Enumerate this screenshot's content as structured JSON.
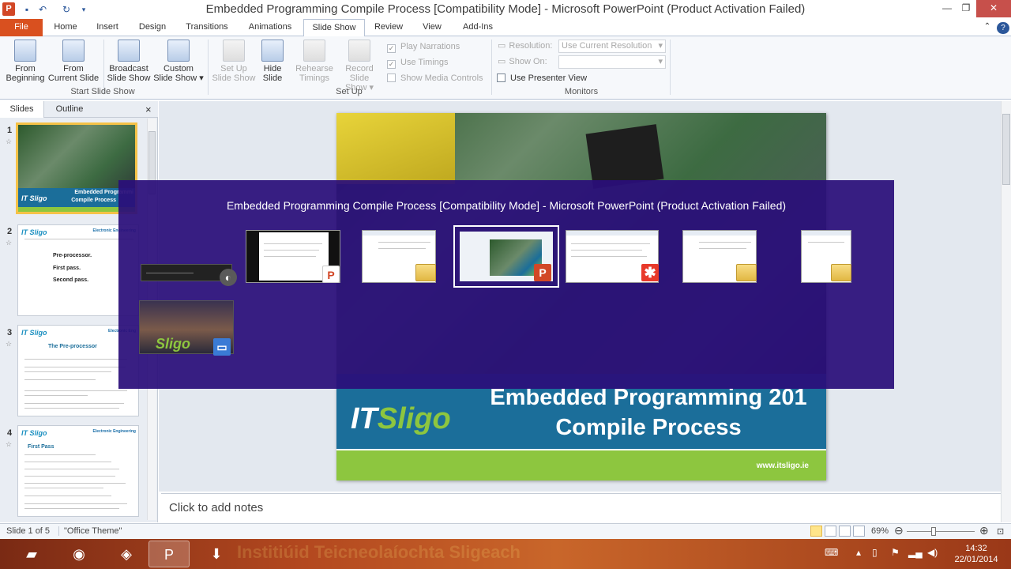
{
  "window": {
    "title": "Embedded Programming Compile Process [Compatibility Mode]  -  Microsoft PowerPoint (Product Activation Failed)",
    "app_icon": "P"
  },
  "ribbon_tabs": [
    "File",
    "Home",
    "Insert",
    "Design",
    "Transitions",
    "Animations",
    "Slide Show",
    "Review",
    "View",
    "Add-Ins"
  ],
  "ribbon": {
    "from_beginning": [
      "From",
      "Beginning"
    ],
    "from_current": [
      "From",
      "Current Slide"
    ],
    "broadcast": [
      "Broadcast",
      "Slide Show"
    ],
    "custom": [
      "Custom",
      "Slide Show"
    ],
    "group_start": "Start Slide Show",
    "setup": [
      "Set Up",
      "Slide Show"
    ],
    "hide": [
      "Hide",
      "Slide"
    ],
    "rehearse": [
      "Rehearse",
      "Timings"
    ],
    "record": [
      "Record Slide",
      "Show"
    ],
    "play_narrations": "Play Narrations",
    "use_timings": "Use Timings",
    "show_media_controls": "Show Media Controls",
    "group_setup": "Set Up",
    "resolution_label": "Resolution:",
    "resolution_value": "Use Current Resolution",
    "show_on_label": "Show On:",
    "show_on_value": "",
    "use_presenter_view": "Use Presenter View",
    "group_monitors": "Monitors"
  },
  "panel": {
    "tab_slides": "Slides",
    "tab_outline": "Outline",
    "close": "×"
  },
  "slides": [
    {
      "num": "1",
      "logo": "IT Sligo",
      "title_a": "Embedded Programmi",
      "title_b": "Compile Process"
    },
    {
      "num": "2",
      "logo": "IT Sligo",
      "header": "Electronic Engineering",
      "lines": [
        "Pre-processor.",
        "First pass.",
        "Second pass."
      ]
    },
    {
      "num": "3",
      "logo": "IT Sligo",
      "header": "Electronic Eng",
      "title": "The Pre-processor"
    },
    {
      "num": "4",
      "logo": "IT Sligo",
      "header": "Electronic Engineering",
      "title": "First Pass"
    }
  ],
  "main_slide": {
    "logo_it": "IT",
    "logo_sligo": "Sligo",
    "title_line1": "Embedded Programming 201",
    "title_line2": "Compile Process",
    "url": "www.itsligo.ie"
  },
  "notes_placeholder": "Click to add notes",
  "status": {
    "slide": "Slide 1 of 5",
    "theme": "\"Office Theme\"",
    "zoom": "69%",
    "zoom_level": 0.69
  },
  "switcher": {
    "title": "Embedded Programming Compile Process [Compatibility Mode] - Microsoft PowerPoint (Product Activation Failed)"
  },
  "taskbar": {
    "watermark": "Institiúid Teicneolaíochta Sligeach",
    "time": "14:32",
    "date": "22/01/2014"
  },
  "colors": {
    "accent_file": "#d9501f",
    "switcher_bg": "#2a0e7a",
    "banner": "#1b6e9a",
    "green": "#8dc63f"
  }
}
